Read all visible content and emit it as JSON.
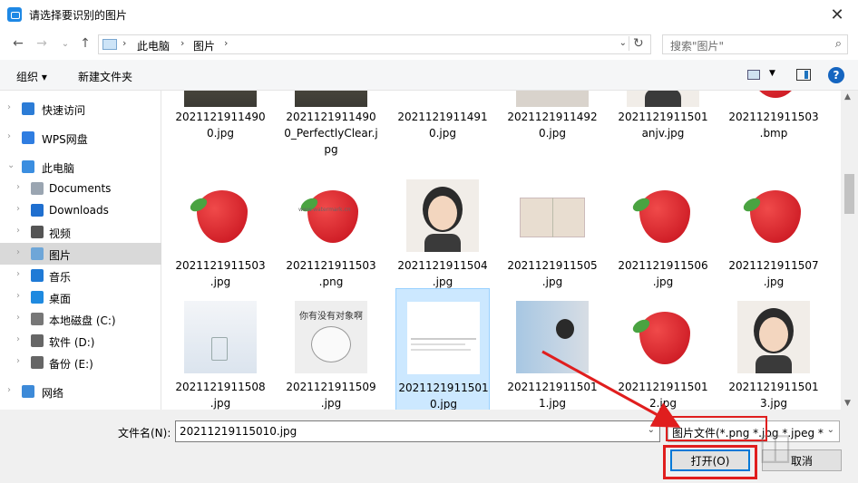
{
  "window": {
    "title": "请选择要识别的图片",
    "close": "✕"
  },
  "nav": {
    "back": "←",
    "forward": "→",
    "history": "⌄",
    "up": "↑",
    "crumbs": [
      "此电脑",
      "图片"
    ],
    "crumb_sep": "›",
    "search_placeholder": "搜索\"图片\""
  },
  "toolbar": {
    "organize": "组织 ▾",
    "new_folder": "新建文件夹",
    "help": "?"
  },
  "sidebar": [
    {
      "label": "快速访问",
      "icon": "star-icon",
      "color": "#2c7cd6"
    },
    {
      "label": "WPS网盘",
      "icon": "cloud-icon",
      "color": "#2f7de1"
    },
    {
      "label": "此电脑",
      "icon": "computer-icon",
      "color": "#3b8ee0"
    },
    {
      "label": "Documents",
      "icon": "document-icon",
      "color": "#9aa5b1"
    },
    {
      "label": "Downloads",
      "icon": "download-icon",
      "color": "#1f6fcf"
    },
    {
      "label": "视频",
      "icon": "video-icon",
      "color": "#555555"
    },
    {
      "label": "图片",
      "icon": "picture-icon",
      "color": "#6ea6d8"
    },
    {
      "label": "音乐",
      "icon": "music-icon",
      "color": "#1f7ad6"
    },
    {
      "label": "桌面",
      "icon": "desktop-icon",
      "color": "#1f8ae0"
    },
    {
      "label": "本地磁盘 (C:)",
      "icon": "drive-c-icon",
      "color": "#777777"
    },
    {
      "label": "软件 (D:)",
      "icon": "drive-icon",
      "color": "#666666"
    },
    {
      "label": "备份 (E:)",
      "icon": "drive-icon",
      "color": "#666666"
    },
    {
      "label": "网络",
      "icon": "network-icon",
      "color": "#3d8ad8"
    }
  ],
  "files": [
    {
      "name": "20211219114900.jpg",
      "lines": [
        "2021121911490",
        "0.jpg"
      ],
      "thumb": "road"
    },
    {
      "name": "20211219114900_PerfectlyClear.jpg",
      "lines": [
        "2021121911490",
        "0_PerfectlyClear.j",
        "pg"
      ],
      "thumb": "road"
    },
    {
      "name": "20211219114910.jpg",
      "lines": [
        "2021121911491",
        "0.jpg"
      ],
      "thumb": "doc"
    },
    {
      "name": "20211219114920.jpg",
      "lines": [
        "2021121911492",
        "0.jpg"
      ],
      "thumb": "person"
    },
    {
      "name": "20211219115010anjv.jpg",
      "lines": [
        "2021121911501",
        "anjv.jpg"
      ],
      "thumb": "girl"
    },
    {
      "name": "20211219115030.bmp",
      "lines": [
        "2021121911503",
        ".bmp"
      ],
      "thumb": "strawberry"
    },
    {
      "name": "20211219115030.jpg",
      "lines": [
        "2021121911503",
        ".jpg"
      ],
      "thumb": "strawberry"
    },
    {
      "name": "20211219115030.png",
      "lines": [
        "2021121911503",
        ".png"
      ],
      "thumb": "strawberry-wm"
    },
    {
      "name": "20211219115040.jpg",
      "lines": [
        "2021121911504",
        ".jpg"
      ],
      "thumb": "girl"
    },
    {
      "name": "20211219115050.jpg",
      "lines": [
        "2021121911505",
        ".jpg"
      ],
      "thumb": "passport"
    },
    {
      "name": "20211219115060.jpg",
      "lines": [
        "2021121911506",
        ".jpg"
      ],
      "thumb": "strawberry"
    },
    {
      "name": "20211219115070.jpg",
      "lines": [
        "2021121911507",
        ".jpg"
      ],
      "thumb": "strawberry"
    },
    {
      "name": "20211219115080.jpg",
      "lines": [
        "2021121911508",
        ".jpg"
      ],
      "thumb": "glass"
    },
    {
      "name": "20211219115090.jpg",
      "lines": [
        "2021121911509",
        ".jpg"
      ],
      "thumb": "hamster",
      "caption": "你有没有对象啊"
    },
    {
      "name": "20211219115010.jpg",
      "lines": [
        "2021121911501",
        "0.jpg"
      ],
      "thumb": "doc",
      "selected": true
    },
    {
      "name": "20211219115011.jpg",
      "lines": [
        "2021121911501",
        "1.jpg"
      ],
      "thumb": "boy"
    },
    {
      "name": "20211219115012.jpg",
      "lines": [
        "2021121911501",
        "2.jpg"
      ],
      "thumb": "strawberry"
    },
    {
      "name": "20211219115013.jpg",
      "lines": [
        "2021121911501",
        "3.jpg"
      ],
      "thumb": "girl"
    }
  ],
  "bottom": {
    "filename_label": "文件名(N):",
    "filename_value": "20211219115010.jpg",
    "filter_value": "图片文件(*.png *.jpg *.jpeg *.",
    "open_label": "打开(O)",
    "cancel_label": "取消"
  },
  "colors": {
    "accent": "#0078d7",
    "highlight": "#e01e1e",
    "selected_bg": "#cce8ff"
  }
}
